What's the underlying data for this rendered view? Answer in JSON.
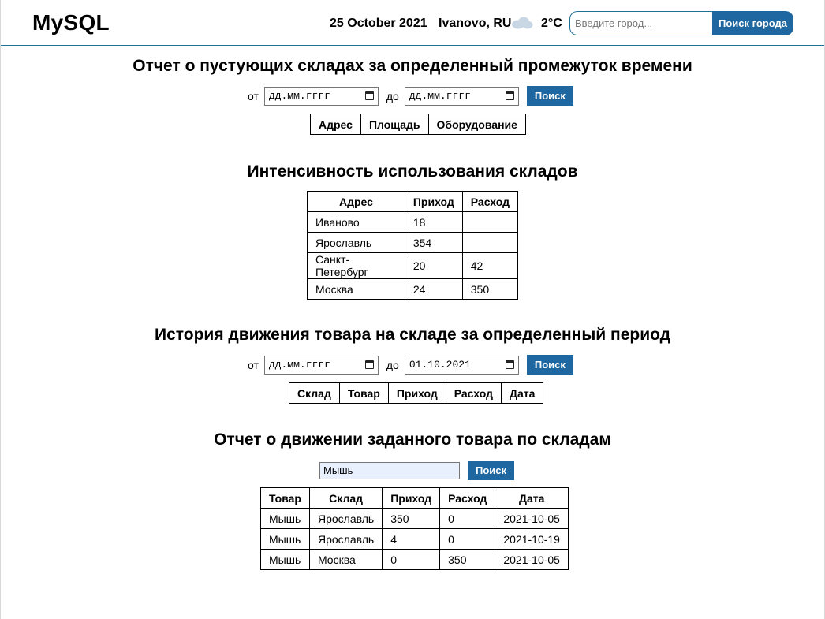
{
  "header": {
    "brand": "MySQL",
    "date": "25 October 2021",
    "city": "Ivanovo, RU",
    "weather_icon": "cloud-icon",
    "temperature": "2°C",
    "city_search": {
      "placeholder": "Введите город...",
      "button_label": "Поиск города"
    },
    "accent_color": "#1e67a1"
  },
  "empty_report": {
    "title": "Отчет о пустующих складах за определенный промежуток времени",
    "from_label": "от",
    "from_value": "дд.мм.гггг",
    "to_label": "до",
    "to_value": "дд.мм.гггг",
    "search_label": "Поиск",
    "columns": [
      "Адрес",
      "Площадь",
      "Оборудование"
    ]
  },
  "intensity": {
    "title": "Интенсивность использования складов",
    "columns": [
      "Адрес",
      "Приход",
      "Расход"
    ],
    "rows": [
      [
        "Иваново",
        "18",
        ""
      ],
      [
        "Ярославль",
        "354",
        ""
      ],
      [
        "Санкт-Петербург",
        "20",
        "42"
      ],
      [
        "Москва",
        "24",
        "350"
      ]
    ]
  },
  "history": {
    "title": "История движения товара на складе за определенный период",
    "from_label": "от",
    "from_value": "дд.мм.гггг",
    "to_label": "до",
    "to_value": "01.10.2021",
    "search_label": "Поиск",
    "columns": [
      "Склад",
      "Товар",
      "Приход",
      "Расход",
      "Дата"
    ]
  },
  "product_report": {
    "title": "Отчет о движении заданного товара по складам",
    "query_value": "Мышь",
    "search_label": "Поиск",
    "columns": [
      "Товар",
      "Склад",
      "Приход",
      "Расход",
      "Дата"
    ],
    "rows": [
      [
        "Мышь",
        "Ярославль",
        "350",
        "0",
        "2021-10-05"
      ],
      [
        "Мышь",
        "Ярославль",
        "4",
        "0",
        "2021-10-19"
      ],
      [
        "Мышь",
        "Москва",
        "0",
        "350",
        "2021-10-05"
      ]
    ]
  }
}
